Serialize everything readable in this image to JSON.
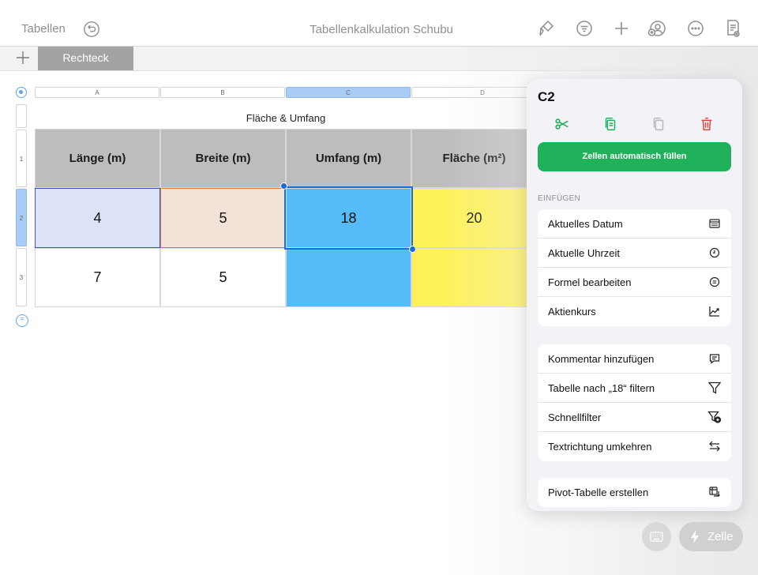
{
  "toolbar": {
    "back_label": "Tabellen",
    "title": "Tabellenkalkulation Schubu"
  },
  "sheets": {
    "active_tab": "Rechteck"
  },
  "table": {
    "title": "Fläche & Umfang",
    "columns": [
      "A",
      "B",
      "C",
      "D"
    ],
    "selected_column": "C",
    "rows": [
      "1",
      "2",
      "3"
    ],
    "selected_row": "2",
    "headers": [
      "Länge (m)",
      "Breite (m)",
      "Umfang (m)",
      "Fläche (m²)"
    ],
    "row2": [
      "4",
      "5",
      "18",
      "20"
    ],
    "row3": [
      "7",
      "5",
      "",
      ""
    ]
  },
  "popover": {
    "cell_ref": "C2",
    "autofill_label": "Zellen automatisch füllen",
    "insert_section": "EINFÜGEN",
    "insert_items": [
      {
        "label": "Aktuelles Datum",
        "icon": "calendar-icon"
      },
      {
        "label": "Aktuelle Uhrzeit",
        "icon": "clock-icon"
      },
      {
        "label": "Formel bearbeiten",
        "icon": "formula-icon"
      },
      {
        "label": "Aktienkurs",
        "icon": "stock-chart-icon"
      }
    ],
    "other_items": [
      {
        "label": "Kommentar hinzufügen",
        "icon": "comment-icon"
      },
      {
        "label": "Tabelle nach „18“ filtern",
        "icon": "filter-icon"
      },
      {
        "label": "Schnellfilter",
        "icon": "quick-filter-icon"
      },
      {
        "label": "Textrichtung umkehren",
        "icon": "text-direction-icon"
      }
    ],
    "pivot_item": {
      "label": "Pivot-Tabelle erstellen",
      "icon": "pivot-table-icon"
    }
  },
  "bottom": {
    "cell_button_label": "Zelle"
  },
  "colors": {
    "header_gray": "#bdbdbd",
    "length_cell": "#dde3f7",
    "width_cell": "#f2e2d8",
    "selected_cell": "#56bcf9",
    "area_cell": "#fdf25a",
    "autofill_green": "#1fb25a",
    "delete_red": "#e0453a",
    "selection_blue": "#1a6ad9"
  }
}
